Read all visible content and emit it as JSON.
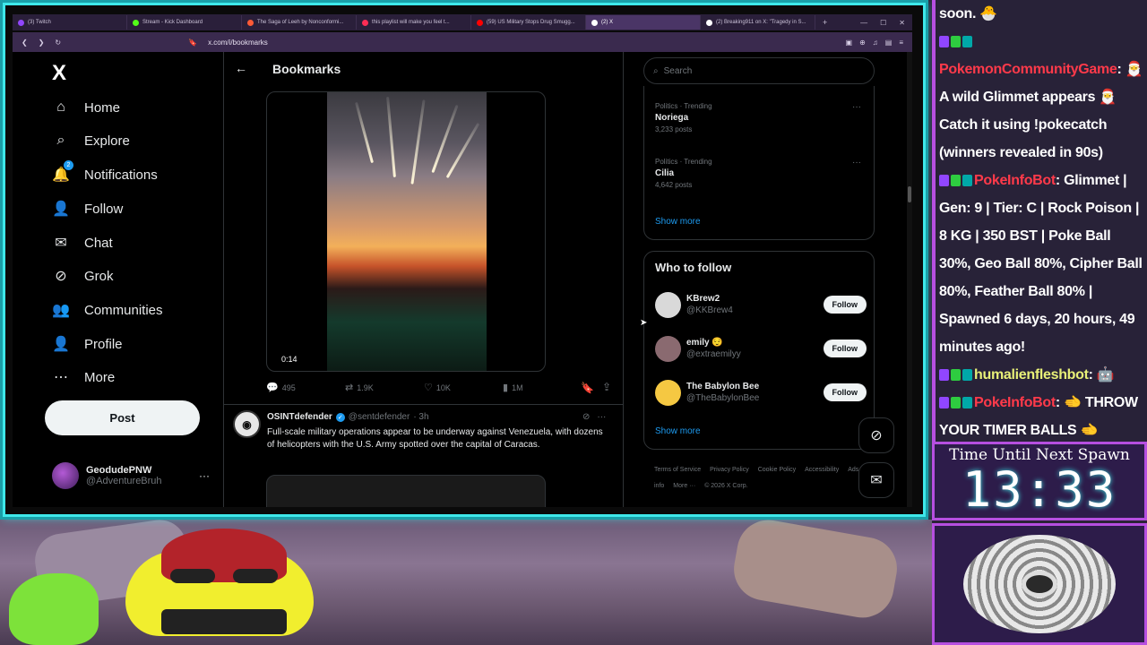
{
  "browser": {
    "tabs": [
      {
        "label": "(3) Twitch",
        "color": "#9146ff",
        "active": false
      },
      {
        "label": "Stream - Kick Dashboard",
        "color": "#53fc18",
        "active": false
      },
      {
        "label": "The Saga of Leeh by Nonconformi...",
        "color": "#ff5a36",
        "active": false
      },
      {
        "label": "this playlist will make you feel t...",
        "color": "#ff2d55",
        "active": false
      },
      {
        "label": "(59) US Military Stops Drug Smugg...",
        "color": "#ff0000",
        "active": false
      },
      {
        "label": "(2) X",
        "color": "#ffffff",
        "active": true
      },
      {
        "label": "(2) Breaking911 on X: \"Tragedy in S...",
        "color": "#ffffff",
        "active": false
      }
    ],
    "url": "x.com/i/bookmarks"
  },
  "nav": {
    "logo": "X",
    "items": [
      {
        "label": "Home",
        "icon": "home-icon",
        "glyph": "⌂"
      },
      {
        "label": "Explore",
        "icon": "search-icon",
        "glyph": "⌕"
      },
      {
        "label": "Notifications",
        "icon": "bell-icon",
        "glyph": "🔔"
      },
      {
        "label": "Follow",
        "icon": "follow-icon",
        "glyph": "👤"
      },
      {
        "label": "Chat",
        "icon": "mail-icon",
        "glyph": "✉"
      },
      {
        "label": "Grok",
        "icon": "grok-icon",
        "glyph": "⊘"
      },
      {
        "label": "Communities",
        "icon": "communities-icon",
        "glyph": "👥"
      },
      {
        "label": "Profile",
        "icon": "profile-icon",
        "glyph": "👤"
      },
      {
        "label": "More",
        "icon": "more-icon",
        "glyph": "⋯"
      }
    ],
    "notification_count": "2",
    "post_label": "Post",
    "profile_name": "GeodudePNW",
    "profile_handle": "@AdventureBruh"
  },
  "center": {
    "title": "Bookmarks",
    "video_time": "0:14",
    "stats": {
      "replies": "495",
      "reposts": "1.9K",
      "likes": "10K",
      "views": "1M"
    },
    "tweet2": {
      "name": "OSINTdefender",
      "handle": "@sentdefender",
      "time": "· 3h",
      "text": "Full-scale military operations appear to be underway against Venezuela, with dozens of helicopters with the U.S. Army spotted over the capital of Caracas."
    }
  },
  "right": {
    "search_placeholder": "Search",
    "trends": [
      {
        "category": "Politics · Trending",
        "name": "Noriega",
        "posts": "3,233 posts"
      },
      {
        "category": "Politics · Trending",
        "name": "Cilia",
        "posts": "4,642 posts"
      }
    ],
    "show_more": "Show more",
    "wtf_title": "Who to follow",
    "follow_label": "Follow",
    "suggestions": [
      {
        "name": "KBrew2",
        "handle": "@KKBrew4",
        "avatar_color": "#d9d9d9"
      },
      {
        "name": "emily 😌",
        "handle": "@extraemilyy",
        "avatar_color": "#8a6a70"
      },
      {
        "name": "The Babylon Bee",
        "handle": "@TheBabylonBee",
        "avatar_color": "#f5c842"
      }
    ],
    "footer": [
      "Terms of Service",
      "Privacy Policy",
      "Cookie Policy",
      "Accessibility",
      "Ads info",
      "More ···",
      "© 2026 X Corp."
    ]
  },
  "chat": {
    "lines": [
      {
        "user": "",
        "text": "soon. 🐣"
      },
      {
        "user": "PokemonCommunityGame",
        "text": ": 🎅 A wild Glimmet appears 🎅 Catch it using !pokecatch (winners revealed in 90s)"
      },
      {
        "user": "PokeInfoBot",
        "text": ": Glimmet | Gen: 9 | Tier: C | Rock Poison | 8 KG | 350 BST | Poke Ball 30%, Geo Ball 80%, Cipher Ball 80%, Feather Ball 80% | Spawned 6 days, 20 hours, 49 minutes ago!"
      },
      {
        "user": "humalienfleshbot",
        "text": ": 🤖",
        "user_color": "#e8f078"
      },
      {
        "user": "PokeInfoBot",
        "text": ": 🫲 THROW YOUR TIMER BALLS 🫲"
      }
    ]
  },
  "timer": {
    "label": "Time Until Next Spawn",
    "value": "13:33"
  }
}
